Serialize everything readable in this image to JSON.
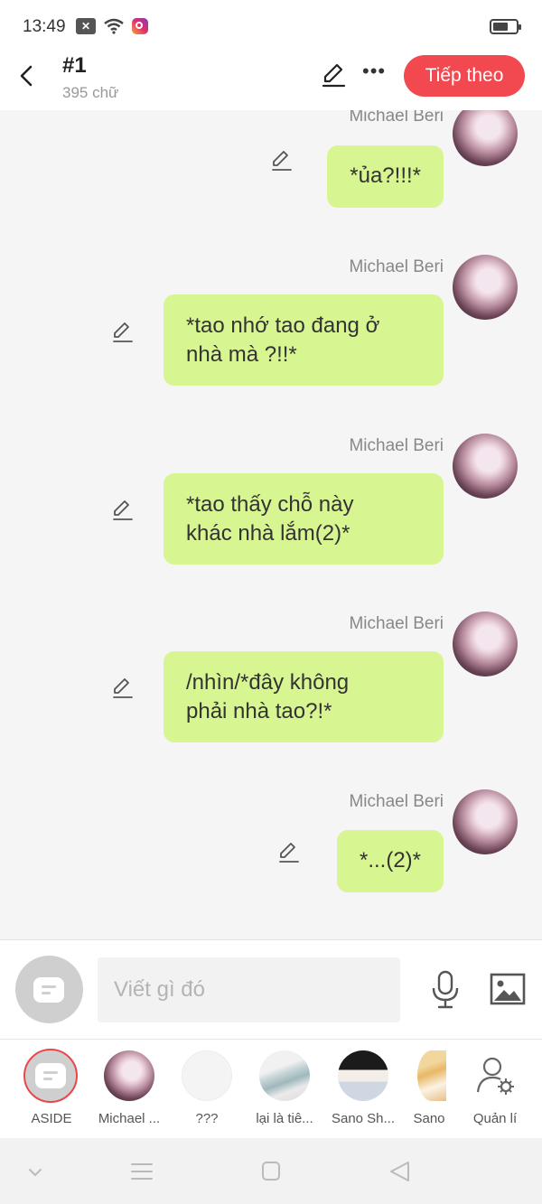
{
  "status_bar": {
    "time": "13:49",
    "icons": [
      "notification-x-icon",
      "wifi-icon",
      "instagram-icon",
      "battery-icon"
    ]
  },
  "header": {
    "title": "#1",
    "word_count": "395 chữ",
    "next_button": "Tiếp theo",
    "accent_color": "#f2484f"
  },
  "messages": [
    {
      "sender": "Michael Beri",
      "lines": [
        "*ủa?!!!*"
      ]
    },
    {
      "sender": "Michael Beri",
      "lines": [
        "*tao nhớ tao đang ở",
        "nhà mà ?!!*"
      ]
    },
    {
      "sender": "Michael Beri",
      "lines": [
        "*tao thấy chỗ này",
        "khác nhà lắm(2)*"
      ]
    },
    {
      "sender": "Michael Beri",
      "lines": [
        "/nhìn/*đây không",
        "phải nhà tao?!*"
      ]
    },
    {
      "sender": "Michael Beri",
      "lines": [
        "*...(2)*"
      ]
    }
  ],
  "bubble_color": "#d7f591",
  "composer": {
    "placeholder": "Viết gì đó",
    "value": ""
  },
  "characters": [
    {
      "label": "ASIDE",
      "selected": true
    },
    {
      "label": "Michael ...",
      "selected": false
    },
    {
      "label": "???",
      "selected": false
    },
    {
      "label": "lại là tiê...",
      "selected": false
    },
    {
      "label": "Sano Sh...",
      "selected": false
    },
    {
      "label": "Sano",
      "selected": false
    },
    {
      "label": "Quản lí",
      "selected": false
    }
  ]
}
